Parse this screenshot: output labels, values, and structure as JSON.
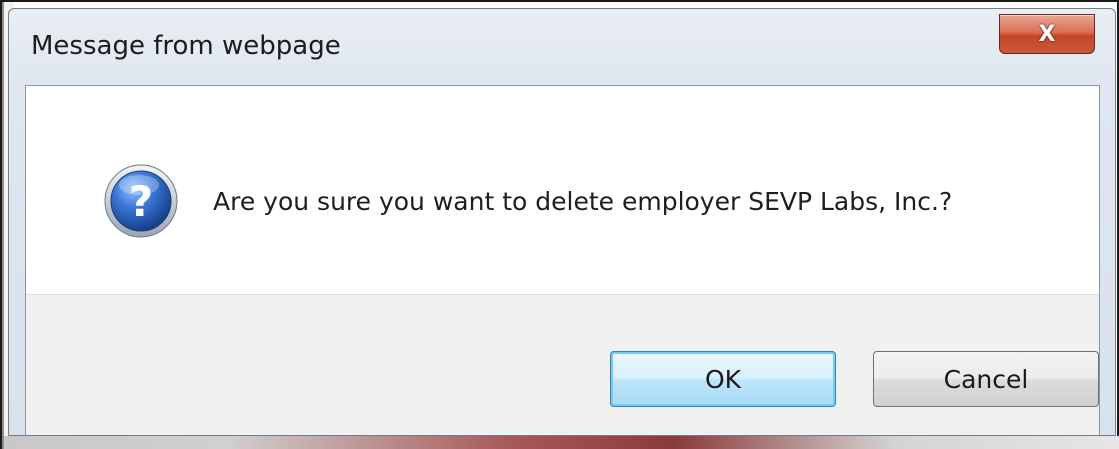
{
  "dialog": {
    "title": "Message from webpage",
    "close_label": "X",
    "message": "Are you sure you want to delete employer SEVP Labs, Inc.?",
    "icon": "question-icon",
    "buttons": {
      "ok_label": "OK",
      "cancel_label": "Cancel"
    }
  },
  "colors": {
    "accent": "#3c7fb1",
    "close_button": "#c5462a",
    "question_icon": "#2a5fb8"
  }
}
